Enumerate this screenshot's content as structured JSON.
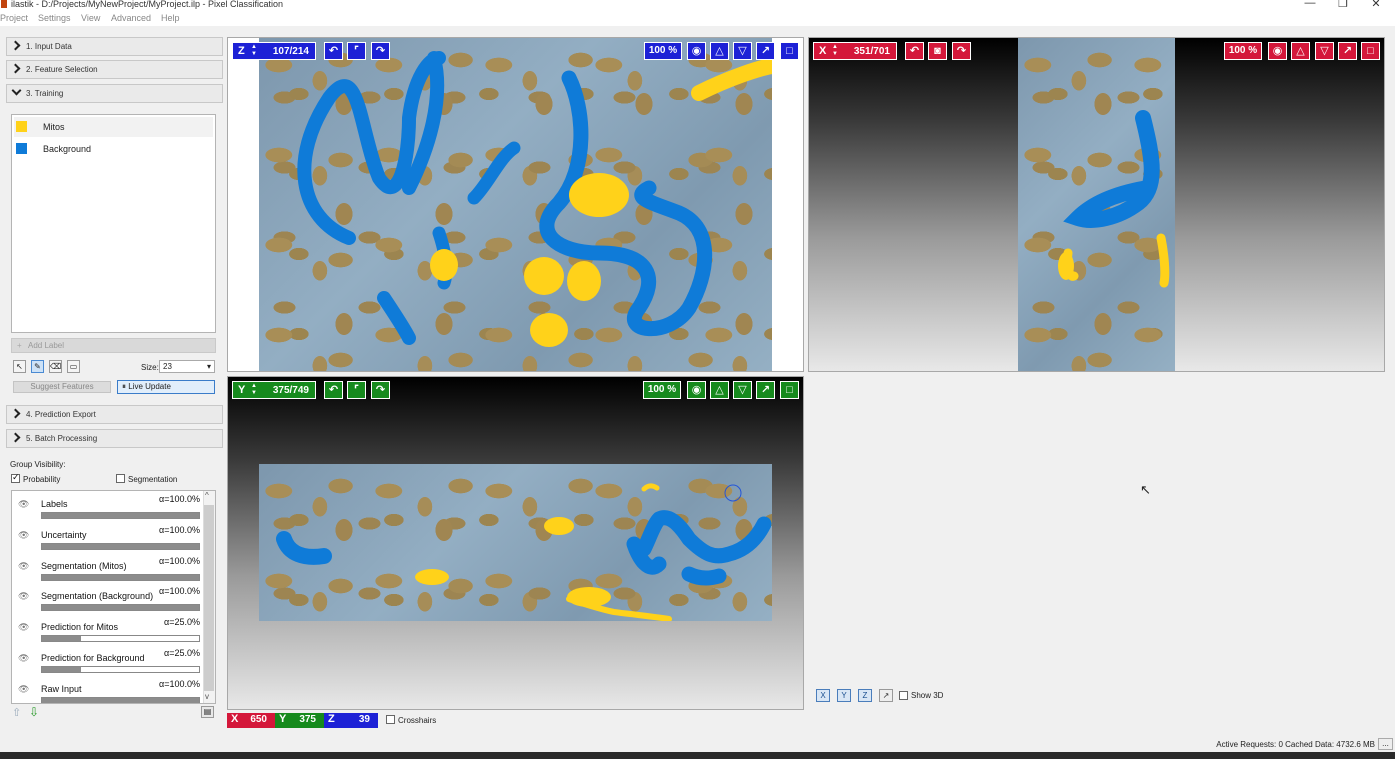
{
  "window": {
    "title": "ilastik - D:/Projects/MyNewProject/MyProject.ilp - Pixel Classification",
    "minimize": "—",
    "maximize": "❐",
    "close": "✕"
  },
  "menu": [
    "Project",
    "Settings",
    "View",
    "Advanced",
    "Help"
  ],
  "applets": [
    {
      "label": "1. Input Data"
    },
    {
      "label": "2. Feature Selection"
    },
    {
      "label": "3. Training"
    },
    {
      "label": "4. Prediction Export"
    },
    {
      "label": "5. Batch Processing"
    }
  ],
  "labels": [
    {
      "name": "Mitos",
      "color": "#ffd21a"
    },
    {
      "name": "Background",
      "color": "#0f7bd8"
    }
  ],
  "training": {
    "add_label": "Add Label",
    "size_label": "Size:",
    "size_value": "23",
    "suggest_features": "Suggest Features",
    "live_update": "Live Update"
  },
  "group_visibility": {
    "title": "Group Visibility:",
    "probability": "Probability",
    "segmentation": "Segmentation"
  },
  "layers": [
    {
      "name": "Labels",
      "opacity": "α=100.0%",
      "value": 1.0
    },
    {
      "name": "Uncertainty",
      "opacity": "α=100.0%",
      "value": 1.0
    },
    {
      "name": "Segmentation (Mitos)",
      "opacity": "α=100.0%",
      "value": 1.0
    },
    {
      "name": "Segmentation (Background)",
      "opacity": "α=100.0%",
      "value": 1.0
    },
    {
      "name": "Prediction for Mitos",
      "opacity": "α=25.0%",
      "value": 0.25
    },
    {
      "name": "Prediction for Background",
      "opacity": "α=25.0%",
      "value": 0.25
    },
    {
      "name": "Raw Input",
      "opacity": "α=100.0%",
      "value": 1.0
    }
  ],
  "viewers": {
    "z": {
      "axis": "Z",
      "position": "107/214",
      "zoom": "100 %"
    },
    "x": {
      "axis": "X",
      "position": "351/701",
      "zoom": "100 %"
    },
    "y": {
      "axis": "Y",
      "position": "375/749",
      "zoom": "100 %"
    }
  },
  "coords": {
    "x_label": "X",
    "x": "650",
    "y_label": "Y",
    "y": "375",
    "z_label": "Z",
    "z": "39"
  },
  "crosshairs": "Crosshairs",
  "show3d": "Show 3D",
  "axis_buttons": [
    "X",
    "Y",
    "Z",
    "↗"
  ],
  "status": "Active Requests: 0  Cached Data: 4732.6 MB",
  "status_more": "..."
}
